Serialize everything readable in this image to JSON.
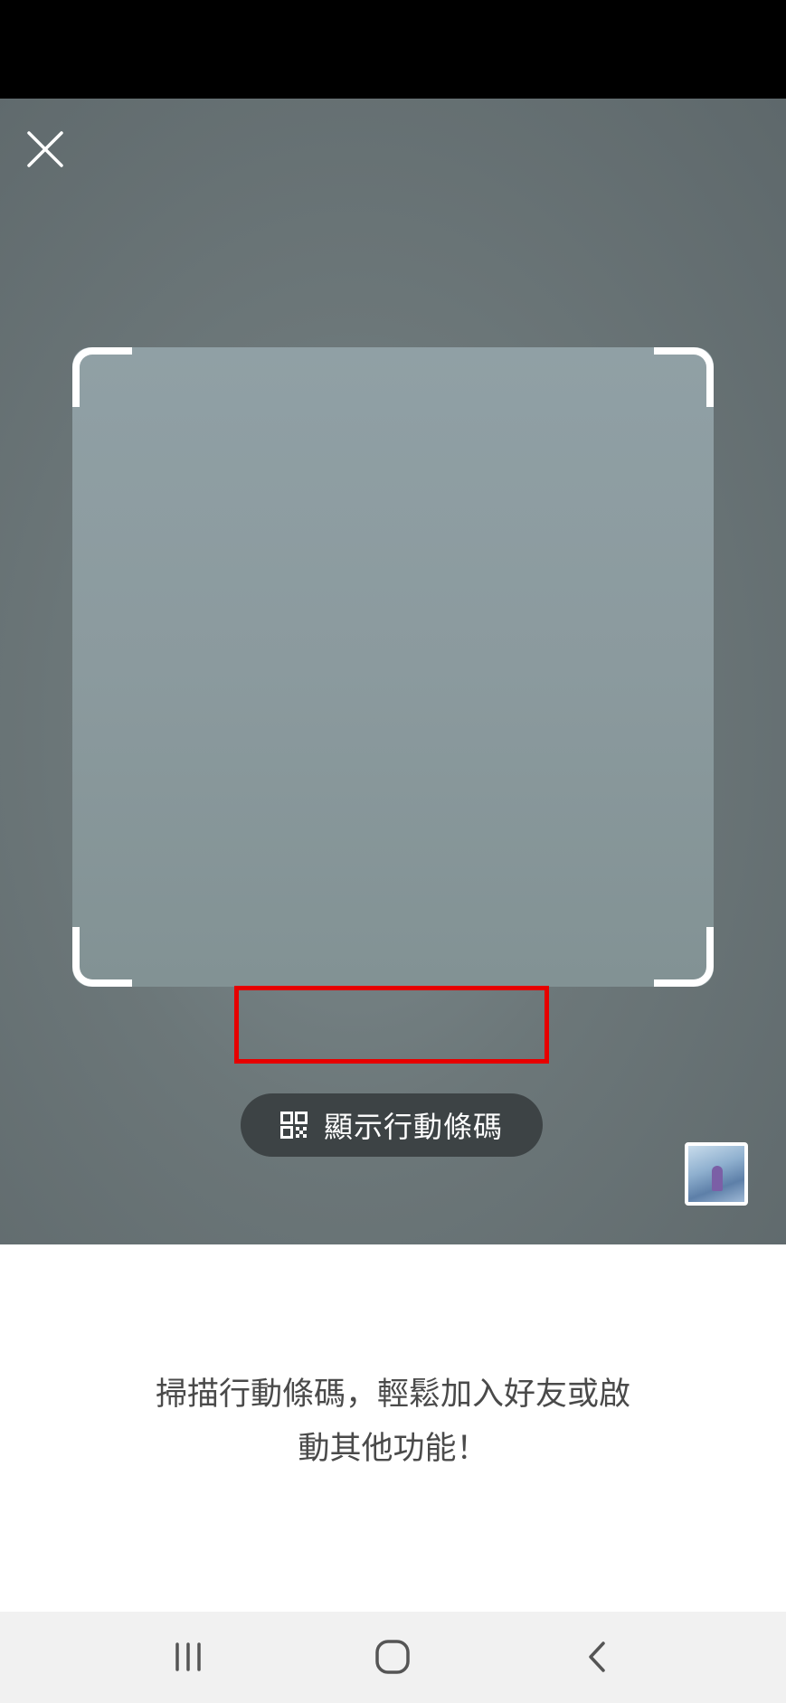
{
  "camera": {
    "show_code_label": "顯示行動條碼",
    "icons": {
      "close": "close-icon",
      "qr": "qr-code-icon",
      "gallery": "gallery-thumbnail"
    }
  },
  "info": {
    "line1": "掃描行動條碼，輕鬆加入好友或啟",
    "line2": "動其他功能！"
  },
  "nav": {
    "icons": [
      "recent-apps-icon",
      "home-icon",
      "back-icon"
    ]
  },
  "colors": {
    "highlight": "#e60000",
    "button_bg": "#3d4345",
    "text": "#4a4a4a"
  }
}
